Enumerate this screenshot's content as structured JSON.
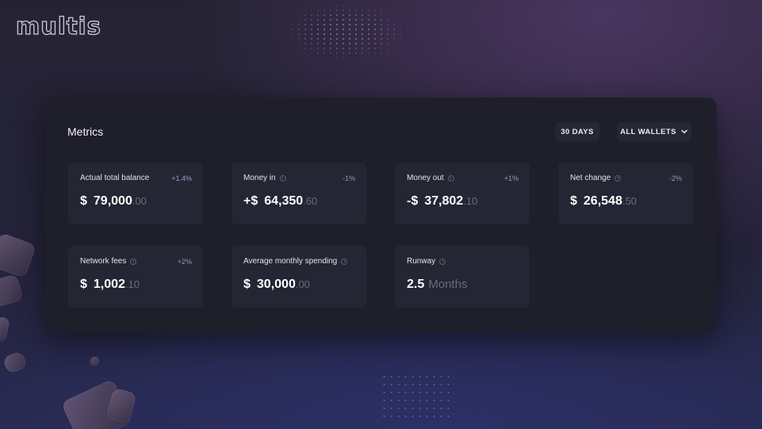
{
  "app": {
    "logo": "multis"
  },
  "metrics": {
    "title": "Metrics",
    "period_label": "30 DAYS",
    "wallets_label": "ALL WALLETS",
    "cards": [
      {
        "label": "Actual total balance",
        "delta": "+1.4%",
        "prefix": "$",
        "amount": "79,000",
        "decimal": ".00"
      },
      {
        "label": "Money in",
        "delta": "-1%",
        "prefix": "+$",
        "amount": "64,350",
        "decimal": ".60"
      },
      {
        "label": "Money out",
        "delta": "+1%",
        "prefix": "-$",
        "amount": "37,802",
        "decimal": ".10"
      },
      {
        "label": "Net change",
        "delta": "-2%",
        "prefix": "$",
        "amount": "26,548",
        "decimal": ".50"
      },
      {
        "label": "Network fees",
        "delta": "+2%",
        "prefix": "$",
        "amount": "1,002",
        "decimal": ".10"
      },
      {
        "label": "Average monthly spending",
        "prefix": "$",
        "amount": "30,000",
        "decimal": ".00"
      },
      {
        "label": "Runway",
        "amount": "2.5",
        "unit": "Months"
      }
    ]
  },
  "colors": {
    "panel": "#1e1f2b",
    "card": "#252633",
    "accent": "#9c95d8"
  }
}
